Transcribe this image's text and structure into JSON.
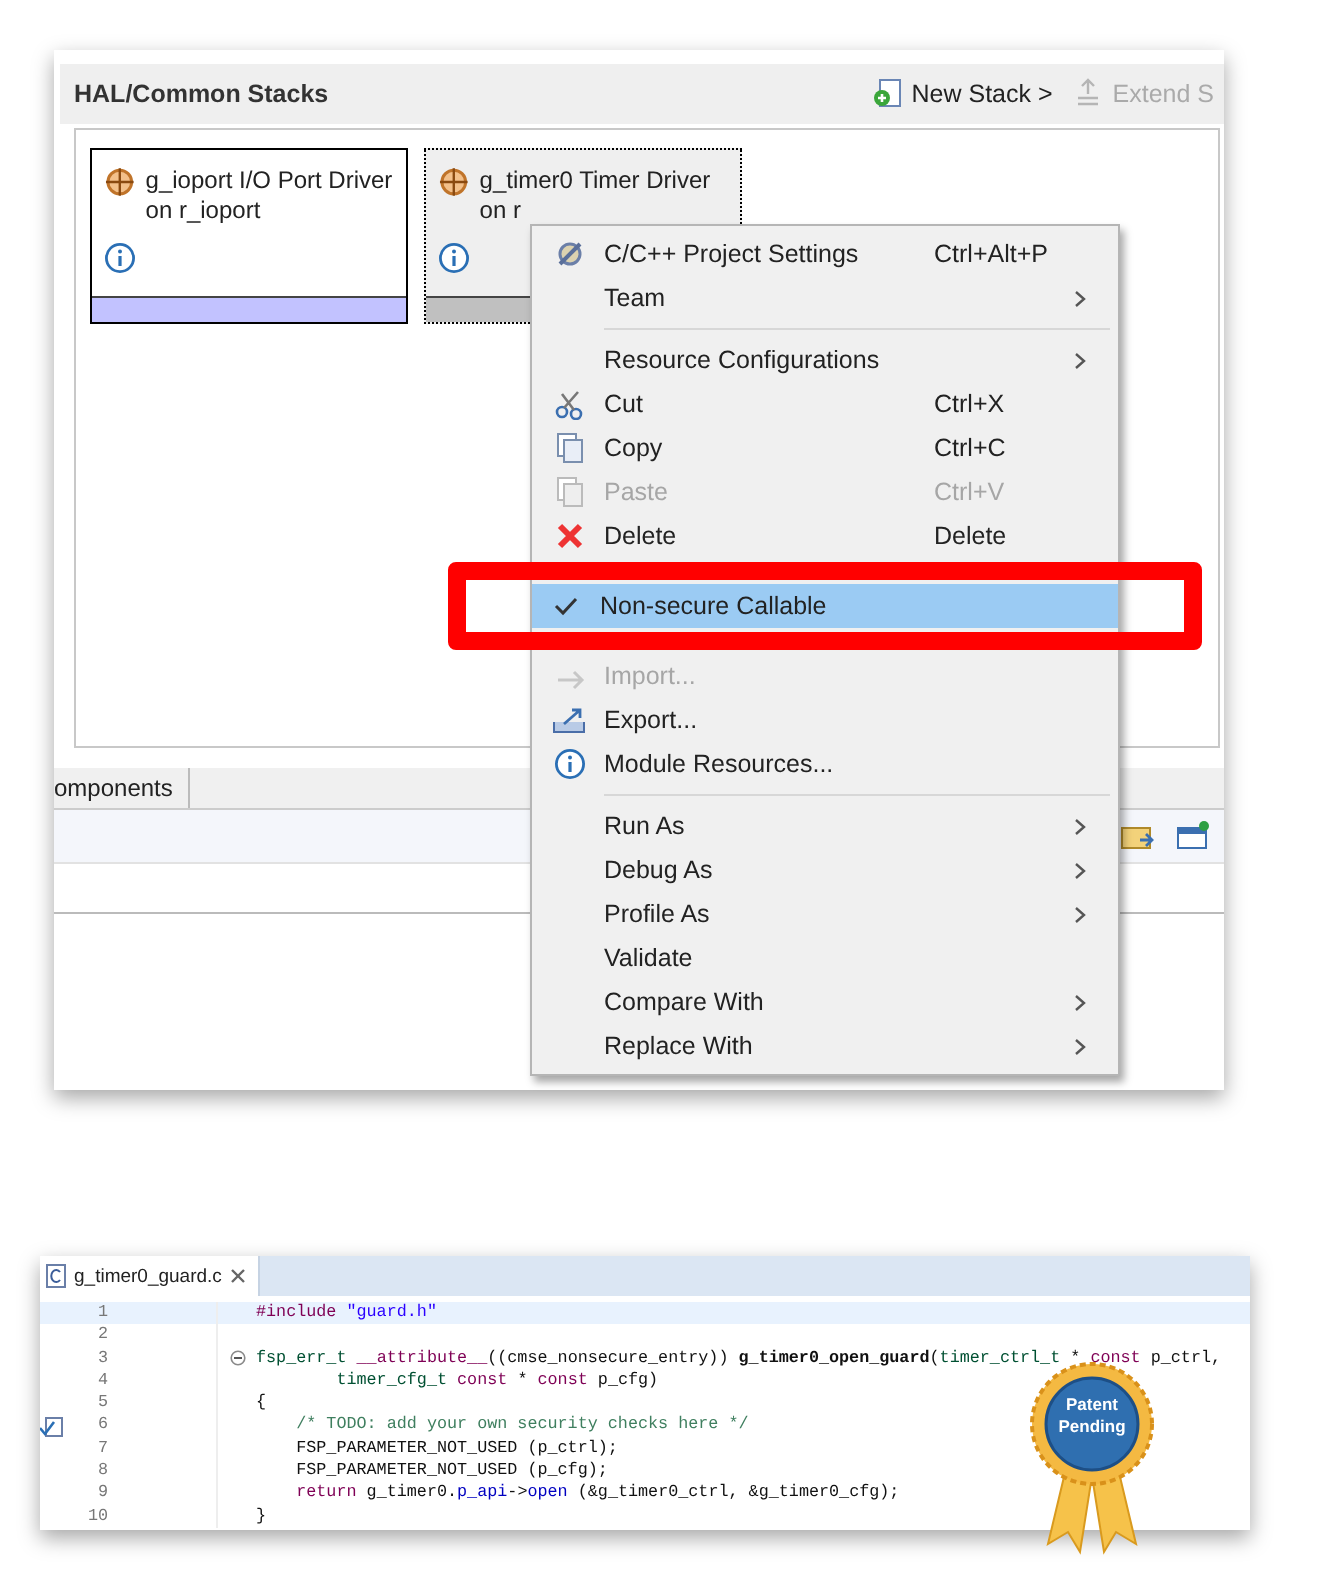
{
  "stacks_panel": {
    "title": "HAL/Common Stacks",
    "toolbar": [
      {
        "label": "New Stack >",
        "disabled": false
      },
      {
        "label": "Extend S",
        "disabled": true
      }
    ],
    "cards": [
      {
        "title": "g_ioport I/O Port Driver on r_ioport",
        "selected": false
      },
      {
        "title": "g_timer0 Timer Driver on r",
        "selected": true
      }
    ]
  },
  "bottom_tab": {
    "label": "omponents"
  },
  "context_menu": {
    "items": [
      {
        "kind": "item",
        "label": "C/C++ Project Settings",
        "shortcut": "Ctrl+Alt+P",
        "submenu": false,
        "disabled": false,
        "checked": false,
        "selected": false,
        "highlighted": false
      },
      {
        "kind": "item",
        "label": "Team",
        "submenu": true,
        "disabled": false,
        "checked": false,
        "selected": false,
        "highlighted": false
      },
      {
        "kind": "separator"
      },
      {
        "kind": "item",
        "label": "Resource Configurations",
        "submenu": true,
        "disabled": false,
        "checked": false,
        "selected": false,
        "highlighted": false
      },
      {
        "kind": "item",
        "label": "Cut",
        "shortcut": "Ctrl+X",
        "submenu": false,
        "disabled": false,
        "checked": false,
        "selected": false,
        "highlighted": false
      },
      {
        "kind": "item",
        "label": "Copy",
        "shortcut": "Ctrl+C",
        "submenu": false,
        "disabled": false,
        "checked": false,
        "selected": false,
        "highlighted": false
      },
      {
        "kind": "item",
        "label": "Paste",
        "shortcut": "Ctrl+V",
        "submenu": false,
        "disabled": true,
        "checked": false,
        "selected": false,
        "highlighted": false
      },
      {
        "kind": "item",
        "label": "Delete",
        "shortcut": "Delete",
        "submenu": false,
        "disabled": false,
        "checked": false,
        "selected": false,
        "highlighted": false
      },
      {
        "kind": "item",
        "label": "Non-secure Callable",
        "submenu": false,
        "disabled": false,
        "checked": true,
        "selected": true,
        "highlighted": true
      },
      {
        "kind": "item",
        "label": "Import...",
        "submenu": false,
        "disabled": true,
        "checked": false,
        "selected": false,
        "highlighted": false
      },
      {
        "kind": "item",
        "label": "Export...",
        "submenu": false,
        "disabled": false,
        "checked": false,
        "selected": false,
        "highlighted": false
      },
      {
        "kind": "item",
        "label": "Module Resources...",
        "submenu": false,
        "disabled": false,
        "checked": false,
        "selected": false,
        "highlighted": false
      },
      {
        "kind": "separator"
      },
      {
        "kind": "item",
        "label": "Run As",
        "submenu": true,
        "disabled": false,
        "checked": false,
        "selected": false,
        "highlighted": false
      },
      {
        "kind": "item",
        "label": "Debug As",
        "submenu": true,
        "disabled": false,
        "checked": false,
        "selected": false,
        "highlighted": false
      },
      {
        "kind": "item",
        "label": "Profile As",
        "submenu": true,
        "disabled": false,
        "checked": false,
        "selected": false,
        "highlighted": false
      },
      {
        "kind": "item",
        "label": "Validate",
        "submenu": false,
        "disabled": false,
        "checked": false,
        "selected": false,
        "highlighted": false
      },
      {
        "kind": "item",
        "label": "Compare With",
        "submenu": true,
        "disabled": false,
        "checked": false,
        "selected": false,
        "highlighted": false
      },
      {
        "kind": "item",
        "label": "Replace With",
        "submenu": true,
        "disabled": false,
        "checked": false,
        "selected": false,
        "highlighted": false
      }
    ]
  },
  "editor": {
    "tab": {
      "label": "g_timer0_guard.c"
    },
    "lines": [
      {
        "number": "1",
        "current": true,
        "fold": false,
        "task": false,
        "tokens": [
          {
            "kind": "preproc",
            "text": "#include "
          },
          {
            "kind": "string",
            "text": "\"guard.h\""
          }
        ]
      },
      {
        "number": "2",
        "current": false,
        "fold": false,
        "task": false
      },
      {
        "number": "3",
        "current": false,
        "fold": true,
        "task": false,
        "tokens": [
          {
            "kind": "type",
            "text": "fsp_err_t "
          },
          {
            "kind": "keyword",
            "text": "__attribute__"
          },
          {
            "kind": "plain",
            "text": "((cmse_nonsecure_entry)) "
          },
          {
            "kind": "function",
            "text": "g_timer0_open_guard"
          },
          {
            "kind": "plain",
            "text": "("
          },
          {
            "kind": "type",
            "text": "timer_ctrl_t"
          },
          {
            "kind": "plain",
            "text": " * "
          },
          {
            "kind": "keyword",
            "text": "const"
          },
          {
            "kind": "plain",
            "text": " p_ctrl,"
          }
        ]
      },
      {
        "number": "4",
        "current": false,
        "fold": false,
        "task": false,
        "tokens": [
          {
            "kind": "type",
            "text": "        timer_cfg_t "
          },
          {
            "kind": "keyword",
            "text": "const"
          },
          {
            "kind": "plain",
            "text": " * "
          },
          {
            "kind": "keyword",
            "text": "const"
          },
          {
            "kind": "plain",
            "text": " p_cfg)"
          }
        ]
      },
      {
        "number": "5",
        "current": false,
        "fold": false,
        "task": false,
        "tokens": [
          {
            "kind": "plain",
            "text": "{"
          }
        ]
      },
      {
        "number": "6",
        "current": false,
        "fold": false,
        "task": true,
        "tokens": [
          {
            "kind": "comment",
            "text": "    /* TODO: add your own security checks here */"
          }
        ]
      },
      {
        "number": "7",
        "current": false,
        "fold": false,
        "task": false,
        "tokens": [
          {
            "kind": "plain",
            "text": "    FSP_PARAMETER_NOT_USED (p_ctrl);"
          }
        ]
      },
      {
        "number": "8",
        "current": false,
        "fold": false,
        "task": false,
        "tokens": [
          {
            "kind": "plain",
            "text": "    FSP_PARAMETER_NOT_USED (p_cfg);"
          }
        ]
      },
      {
        "number": "9",
        "current": false,
        "fold": false,
        "task": false,
        "tokens": [
          {
            "kind": "keyword",
            "text": "    return"
          },
          {
            "kind": "plain",
            "text": " g_timer0."
          },
          {
            "kind": "field",
            "text": "p_api"
          },
          {
            "kind": "plain",
            "text": "->"
          },
          {
            "kind": "field",
            "text": "open"
          },
          {
            "kind": "plain",
            "text": " (&g_timer0_ctrl, &g_timer0_cfg);"
          }
        ]
      },
      {
        "number": "10",
        "current": false,
        "fold": false,
        "task": false,
        "tokens": [
          {
            "kind": "plain",
            "text": "}"
          }
        ]
      }
    ]
  },
  "badge": {
    "text": "Patent Pending"
  }
}
